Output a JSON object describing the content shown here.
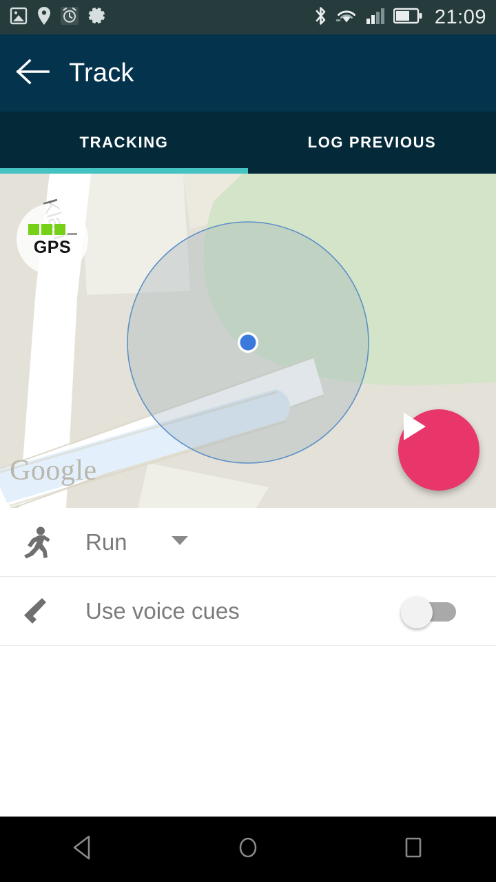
{
  "statusbar": {
    "time": "21:09",
    "left_icons": [
      "image-icon",
      "location-pin-icon",
      "alarm-clock-icon",
      "gear-icon"
    ],
    "right_icons": [
      "bluetooth-icon",
      "wifi-icon",
      "cellular-signal-icon",
      "battery-icon"
    ],
    "battery_level_pct": 60,
    "background": "#263b3c"
  },
  "appbar": {
    "title": "Track",
    "back_icon": "arrow-left-icon",
    "background": "#04334d"
  },
  "tabs": {
    "items": [
      {
        "label": "TRACKING",
        "active": true
      },
      {
        "label": "LOG PREVIOUS",
        "active": false
      }
    ],
    "indicator_color": "#45c3c2",
    "background": "#042a3a"
  },
  "map": {
    "provider_watermark": "Google",
    "street_label": "Klaris",
    "gps": {
      "label": "GPS",
      "bars_total": 4,
      "bars_active": 3,
      "bar_color": "#76d017"
    },
    "location_dot_color": "#3b79dc",
    "accuracy_circle_stroke": "#5b90c8",
    "park_color": "#d3e4c8",
    "land_color": "#e4e2d8",
    "road_color": "#ffffff",
    "water_color": "#e3f0fb"
  },
  "fab": {
    "action": "start-tracking",
    "icon": "play-icon",
    "color": "#e8366a"
  },
  "rows": [
    {
      "name": "activity-type",
      "icon": "running-person-icon",
      "label": "Run",
      "control": "dropdown",
      "caret_icon": "caret-down-icon"
    },
    {
      "name": "voice-cues",
      "icon": "megaphone-icon",
      "label": "Use voice cues",
      "control": "toggle",
      "value": "off"
    }
  ],
  "navbar": {
    "buttons": [
      {
        "name": "back",
        "icon": "triangle-back-icon"
      },
      {
        "name": "home",
        "icon": "circle-home-icon"
      },
      {
        "name": "recents",
        "icon": "square-recents-icon"
      }
    ],
    "background": "#000000"
  }
}
